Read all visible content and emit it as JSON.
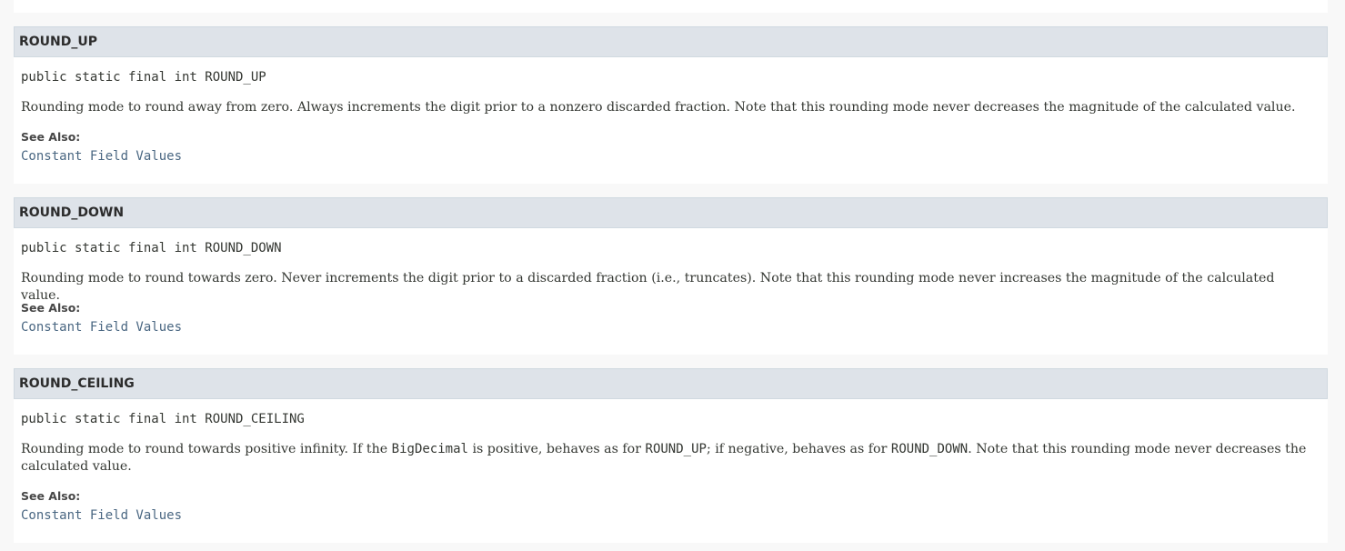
{
  "fields": [
    {
      "name": "ROUND_UP",
      "signature": "public static final int ROUND_UP",
      "description": "Rounding mode to round away from zero. Always increments the digit prior to a nonzero discarded fraction. Note that this rounding mode never decreases the magnitude of the calculated value.",
      "see_also_label": "See Also:",
      "see_also_link": "Constant Field Values"
    },
    {
      "name": "ROUND_DOWN",
      "signature": "public static final int ROUND_DOWN",
      "description": "Rounding mode to round towards zero. Never increments the digit prior to a discarded fraction (i.e., truncates). Note that this rounding mode never increases the magnitude of the calculated value.",
      "see_also_label": "See Also:",
      "see_also_link": "Constant Field Values"
    },
    {
      "name": "ROUND_CEILING",
      "signature": "public static final int ROUND_CEILING",
      "description_parts": [
        "Rounding mode to round towards positive infinity. If the ",
        "BigDecimal",
        " is positive, behaves as for ",
        "ROUND_UP",
        "; if negative, behaves as for ",
        "ROUND_DOWN",
        ". Note that this rounding mode never decreases the calculated value."
      ],
      "see_also_label": "See Also:",
      "see_also_link": "Constant Field Values"
    }
  ]
}
